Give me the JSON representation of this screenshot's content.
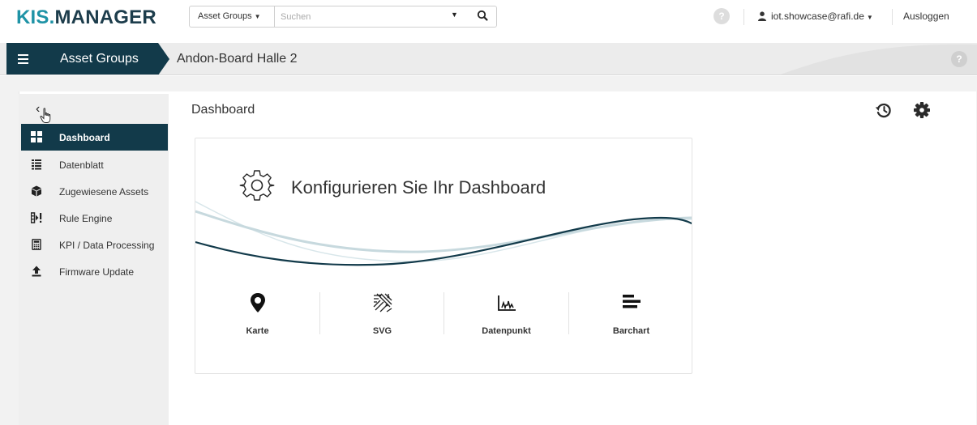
{
  "app": {
    "logo_part1": "KIS.",
    "logo_part2": "MANAGER"
  },
  "search": {
    "scope_label": "Asset Groups",
    "placeholder": "Suchen"
  },
  "user": {
    "email": "iot.showcase@rafi.de",
    "logout_label": "Ausloggen",
    "help_label": "?"
  },
  "breadcrumb": {
    "root": "Asset Groups",
    "current": "Andon-Board Halle 2",
    "help_label": "?"
  },
  "sidebar": {
    "back_label": "‹",
    "items": [
      {
        "label": "Dashboard",
        "icon": "grid-icon",
        "active": true
      },
      {
        "label": "Datenblatt",
        "icon": "list-icon",
        "active": false
      },
      {
        "label": "Zugewiesene Assets",
        "icon": "cube-icon",
        "active": false
      },
      {
        "label": "Rule Engine",
        "icon": "rule-engine-icon",
        "active": false
      },
      {
        "label": "KPI / Data Processing",
        "icon": "calculator-icon",
        "active": false
      },
      {
        "label": "Firmware Update",
        "icon": "upload-icon",
        "active": false
      }
    ]
  },
  "main": {
    "title": "Dashboard",
    "card_title": "Konfigurieren Sie Ihr Dashboard",
    "widgets": [
      {
        "label": "Karte",
        "icon": "map-marker-icon"
      },
      {
        "label": "SVG",
        "icon": "svg-circuit-icon"
      },
      {
        "label": "Datenpunkt",
        "icon": "datapoint-chart-icon"
      },
      {
        "label": "Barchart",
        "icon": "barchart-icon"
      }
    ]
  },
  "colors": {
    "brand_teal": "#1f93a6",
    "brand_dark": "#123a4a"
  }
}
